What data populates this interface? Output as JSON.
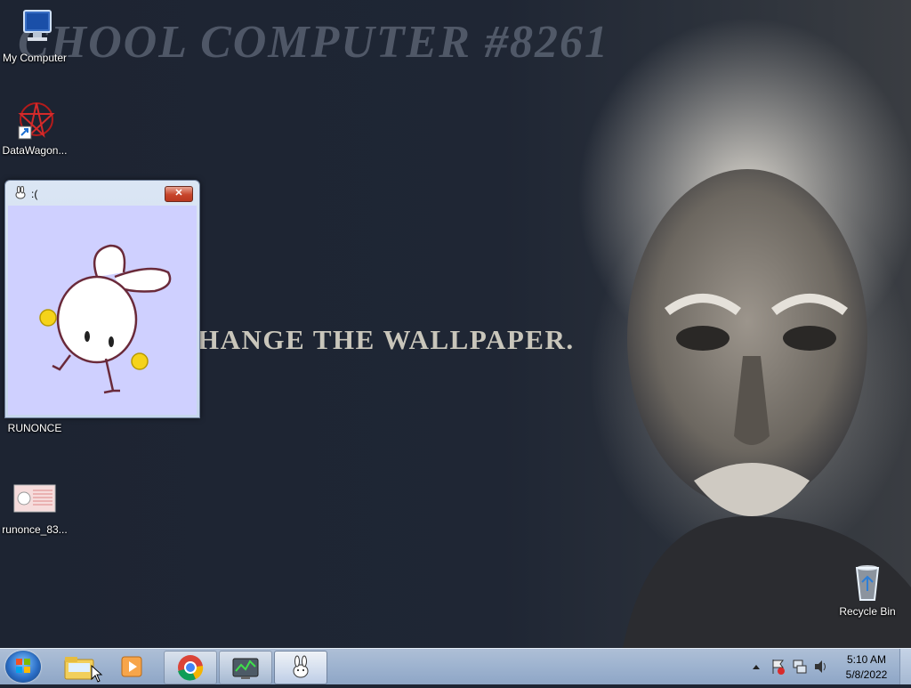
{
  "wallpaper": {
    "title": "CHOOL COMPUTER #8261",
    "subtitle": "HANGE THE WALLPAPER."
  },
  "desktop_icons": [
    {
      "label": "My Computer",
      "icon": "computer-icon"
    },
    {
      "label": "DataWagon...",
      "icon": "datawagon-icon"
    },
    {
      "label": "RUNONCE",
      "icon": "runonce-icon"
    },
    {
      "label": "runonce_83...",
      "icon": "image-file-icon"
    },
    {
      "label": "Recycle Bin",
      "icon": "recycle-bin-icon"
    }
  ],
  "window": {
    "title": ":(",
    "close_glyph": "✕"
  },
  "taskbar": {
    "pinned": [
      "file-explorer-icon",
      "media-player-icon",
      "chrome-icon",
      "task-manager-icon",
      "rabbit-app-icon"
    ],
    "clock": {
      "time": "5:10 AM",
      "date": "5/8/2022"
    }
  },
  "colors": {
    "window_client": "#cfd0ff",
    "taskbar": "#9fb4d0",
    "desktop": "#1e2533"
  }
}
